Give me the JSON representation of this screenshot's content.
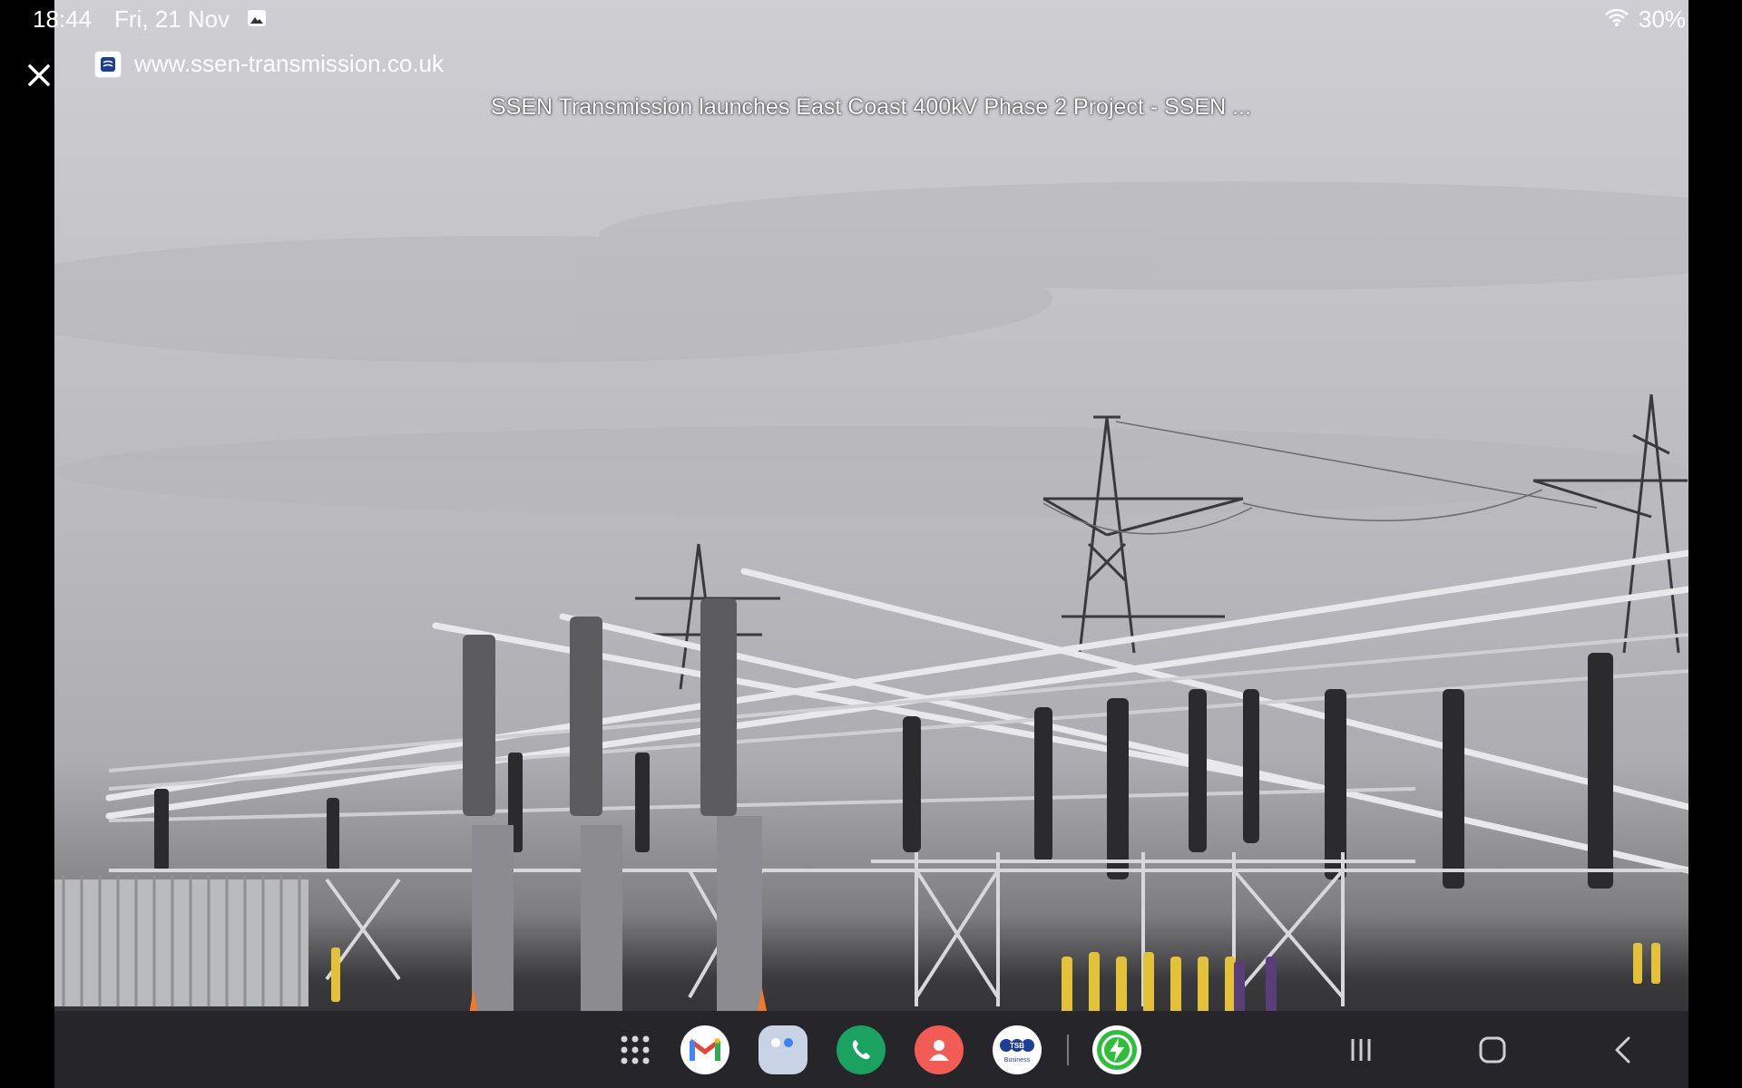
{
  "status_bar": {
    "time": "18:44",
    "date": "Fri, 21 Nov",
    "battery": "30%",
    "icons": [
      "gallery-icon",
      "wifi-icon"
    ]
  },
  "viewer": {
    "close_icon": "close-icon",
    "site_favicon": "ssen-favicon",
    "site_url": "www.ssen-transmission.co.uk",
    "page_title": "SSEN Transmission launches East Coast 400kV Phase 2 Project - SSEN ..."
  },
  "dock": {
    "apps": [
      "Apps",
      "Gmail",
      "Folder",
      "Phone",
      "Contacts",
      "TSB Business",
      "Power app"
    ]
  },
  "tsb_logo": {
    "top": "TSB",
    "bottom": "Business"
  },
  "nav_bar": [
    "recent-apps-icon",
    "home-icon",
    "back-icon"
  ],
  "colors": {
    "gmail_red": "#ea4335",
    "phone_green": "#1aa260",
    "contacts_red": "#f25c54",
    "tsb_blue": "#1c3f94",
    "power_green": "#2dbf3a"
  }
}
